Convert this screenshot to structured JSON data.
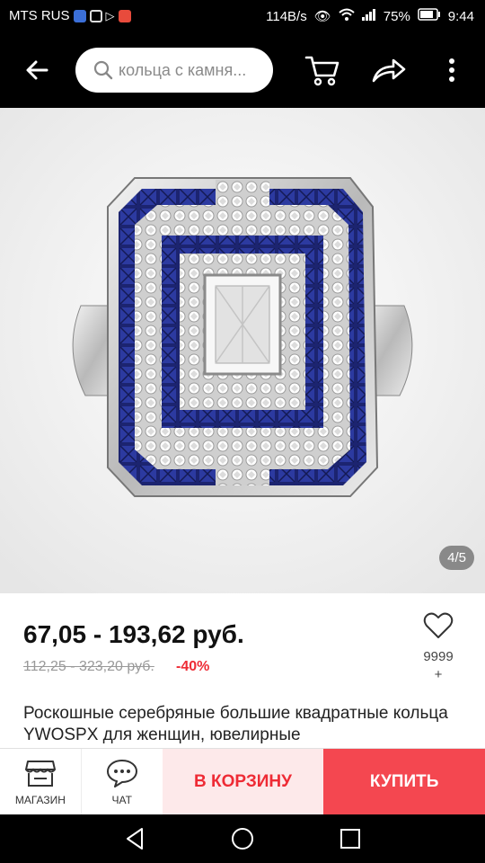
{
  "status": {
    "carrier": "MTS RUS",
    "speed": "114B/s",
    "battery": "75%",
    "time": "9:44"
  },
  "header": {
    "search_placeholder": "кольца с камня..."
  },
  "gallery": {
    "counter": "4/5"
  },
  "product": {
    "price": "67,05 - 193,62 руб.",
    "old_price": "112,25 - 323,20 руб.",
    "discount": "-40%",
    "favorites_count": "9999",
    "favorites_plus": "+",
    "title": "Роскошные серебряные большие квадратные кольца YWOSPX для женщин, ювелирные"
  },
  "bottom_bar": {
    "store_label": "МАГАЗИН",
    "chat_label": "ЧАТ",
    "cart_label": "В КОРЗИНУ",
    "buy_label": "КУПИТЬ"
  },
  "colors": {
    "accent": "#ee2b35",
    "buy_button": "#f44750",
    "cart_button_bg": "#fde9ea"
  }
}
